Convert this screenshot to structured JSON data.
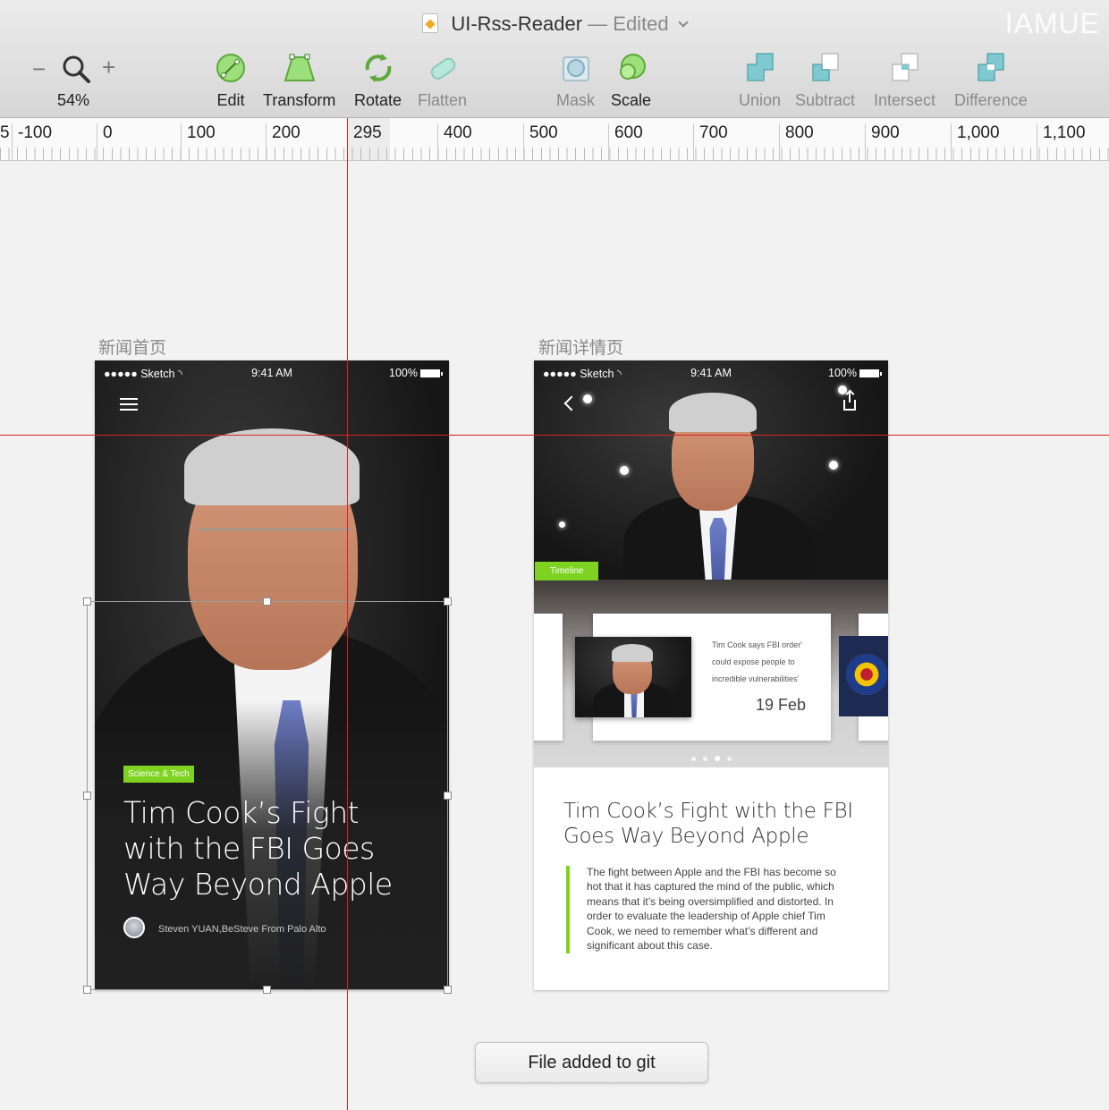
{
  "window": {
    "doc_name": "UI-Rss-Reader",
    "edited_state": "— Edited",
    "brand": "IAMUE"
  },
  "toolbar": {
    "zoom": {
      "value": "54%",
      "minus": "−",
      "plus": "+"
    },
    "tools": [
      {
        "label": "Edit",
        "icon": "edit-icon"
      },
      {
        "label": "Transform",
        "icon": "transform-icon"
      },
      {
        "label": "Rotate",
        "icon": "rotate-icon"
      },
      {
        "label": "Flatten",
        "icon": "flatten-icon"
      },
      {
        "label": "Mask",
        "icon": "mask-icon"
      },
      {
        "label": "Scale",
        "icon": "scale-icon"
      },
      {
        "label": "Union",
        "icon": "union-icon"
      },
      {
        "label": "Subtract",
        "icon": "subtract-icon"
      },
      {
        "label": "Intersect",
        "icon": "intersect-icon"
      },
      {
        "label": "Difference",
        "icon": "difference-icon"
      }
    ],
    "colors": {
      "green": "#7ed321",
      "teal": "#6fc3c8"
    }
  },
  "ruler": {
    "labels": [
      "5",
      "-100",
      "0",
      "100",
      "200",
      "295",
      "400",
      "500",
      "600",
      "700",
      "800",
      "900",
      "1,000",
      "1,100"
    ]
  },
  "artboards": {
    "home": {
      "title": "新闻首页",
      "status": {
        "carrier": "●●●●● Sketch",
        "time": "9:41 AM",
        "battery": "100%"
      },
      "badge": "Science & Tech",
      "headline": "Tim Cook’s Fight with the FBI Goes Way Beyond Apple",
      "author": "Steven YUAN,BeSteve From Palo Alto"
    },
    "detail": {
      "title": "新闻详情页",
      "status": {
        "carrier": "●●●●● Sketch",
        "time": "9:41 AM",
        "battery": "100%"
      },
      "badge": "Timeline",
      "card": {
        "quote": "Tim Cook says FBI order' could expose people to incredible vulnerabilities'",
        "date": "19 Feb"
      },
      "headline": "Tim Cook’s Fight with the FBI Goes Way Beyond Apple",
      "body": "The fight between Apple and the FBI has become so hot that it has captured the mind of the public, which means that it’s being oversimplified and distorted. In order to evaluate the leadership of Apple chief Tim Cook, we need to remember what’s different and significant about this case."
    }
  },
  "notification": {
    "text": "File added to git"
  },
  "colors": {
    "guide": "#e02020",
    "accent_green": "#7ed321"
  }
}
